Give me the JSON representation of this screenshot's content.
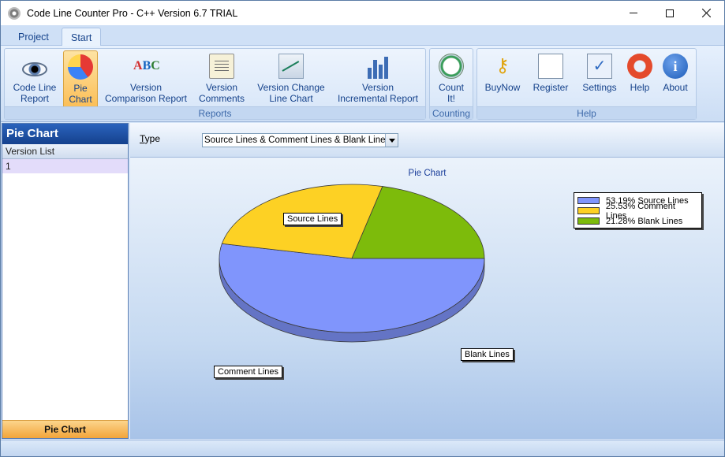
{
  "window": {
    "title": "Code Line Counter Pro - C++ Version 6.7 TRIAL"
  },
  "ribbon_tabs": [
    {
      "label": "Project",
      "active": false
    },
    {
      "label": "Start",
      "active": true
    }
  ],
  "ribbon": {
    "groups": {
      "reports": {
        "label": "Reports",
        "buttons": [
          {
            "label": "Code Line\nReport",
            "icon": "eye-icon"
          },
          {
            "label": "Pie\nChart",
            "icon": "pie-chart-icon",
            "active": true
          },
          {
            "label": "Version\nComparison Report",
            "icon": "abc-icon"
          },
          {
            "label": "Version\nComments",
            "icon": "notepad-icon"
          },
          {
            "label": "Version Change\nLine Chart",
            "icon": "line-chart-icon"
          },
          {
            "label": "Version\nIncremental Report",
            "icon": "bar-chart-icon"
          }
        ]
      },
      "counting": {
        "label": "Counting",
        "buttons": [
          {
            "label": "Count\nIt!",
            "icon": "clock-icon"
          }
        ]
      },
      "help": {
        "label": "Help",
        "buttons": [
          {
            "label": "BuyNow",
            "icon": "key-icon"
          },
          {
            "label": "Register",
            "icon": "envelope-icon"
          },
          {
            "label": "Settings",
            "icon": "checklist-icon"
          },
          {
            "label": "Help",
            "icon": "lifebuoy-icon"
          },
          {
            "label": "About",
            "icon": "info-icon"
          }
        ]
      }
    }
  },
  "left_panel": {
    "title": "Pie Chart",
    "column_header": "Version List",
    "rows": [
      "1"
    ],
    "footer": "Pie Chart"
  },
  "main": {
    "type_label": "Type",
    "type_value": "Source Lines & Comment Lines & Blank Lines"
  },
  "chart_data": {
    "type": "pie",
    "title": "Pie Chart",
    "categories": [
      "Source Lines",
      "Comment Lines",
      "Blank Lines"
    ],
    "values": [
      53.19,
      25.53,
      21.28
    ],
    "colors": [
      "#8095fc",
      "#fdd124",
      "#7dbb0b"
    ],
    "legend": [
      "53.19% Source Lines",
      "25.53% Comment Lines",
      "21.28% Blank Lines"
    ],
    "legend_position": "top-right"
  }
}
